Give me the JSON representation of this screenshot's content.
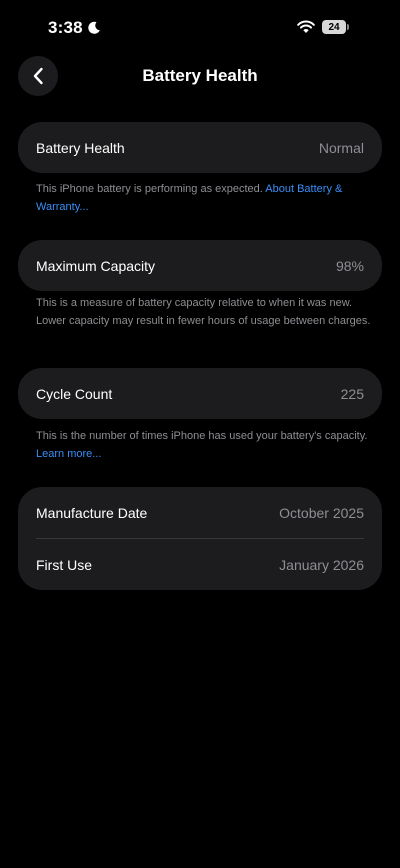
{
  "status_bar": {
    "time": "3:38",
    "battery_level": "24"
  },
  "nav": {
    "title": "Battery Health"
  },
  "battery_health": {
    "label": "Battery Health",
    "value": "Normal",
    "note": "This iPhone battery is performing as expected. ",
    "link": "About Battery & Warranty..."
  },
  "maximum_capacity": {
    "label": "Maximum Capacity",
    "value": "98%",
    "note": "This is a measure of battery capacity relative to when it was new. Lower capacity may result in fewer hours of usage between charges."
  },
  "cycle_count": {
    "label": "Cycle Count",
    "value": "225",
    "note": "This is the number of times iPhone has used your battery's capacity. ",
    "link": "Learn more..."
  },
  "dates": {
    "manufacture_label": "Manufacture Date",
    "manufacture_value": "October 2025",
    "first_use_label": "First Use",
    "first_use_value": "January 2026"
  },
  "colors": {
    "background": "#000000",
    "card": "#1c1c1e",
    "secondary_text": "#8e8e93",
    "link": "#3a8ef6"
  },
  "icons": {
    "moon": "moon-icon",
    "wifi": "wifi-icon",
    "battery": "battery-icon",
    "back": "chevron-left-icon"
  }
}
